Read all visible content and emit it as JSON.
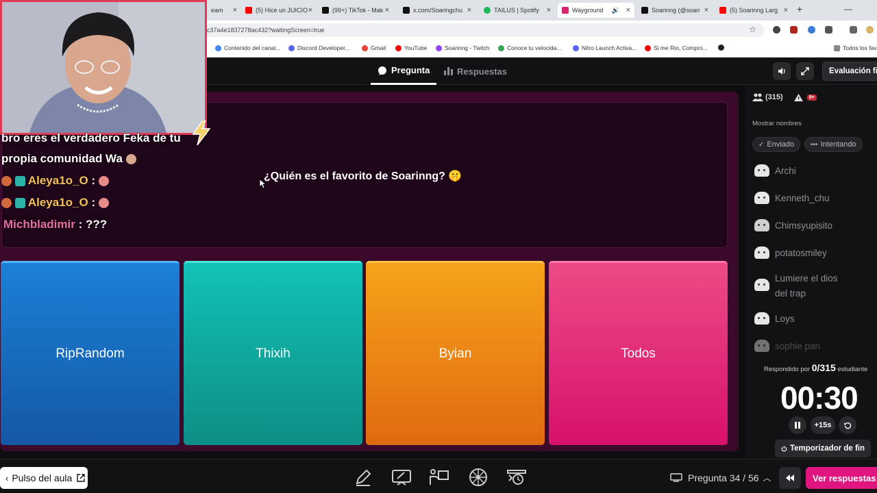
{
  "browser": {
    "tabs": [
      {
        "title": "eam",
        "favicon_color": "#9146ff"
      },
      {
        "title": "(5) Hice un JUICIO",
        "favicon_color": "#ff0000"
      },
      {
        "title": "(99+) TikTok - Mak",
        "favicon_color": "#111111"
      },
      {
        "title": "x.com/Soaringchu",
        "favicon_color": "#111111"
      },
      {
        "title": "TAILUS | Spotify",
        "favicon_color": "#1db954"
      },
      {
        "title": "Wayground",
        "favicon_color": "#d6246e"
      },
      {
        "title": "Soarinng (@soari",
        "favicon_color": "#111111"
      },
      {
        "title": "(5) Soarinng Larg",
        "favicon_color": "#ff0000"
      }
    ],
    "new_tab": "+",
    "url": "c37a4e1837278ac432?waitingScreen=true",
    "bookmarks": [
      {
        "label": "Contenido del canal...",
        "color": "#4285f4"
      },
      {
        "label": "Discord Developer...",
        "color": "#5865f2"
      },
      {
        "label": "Gmail",
        "color": "#ea4335"
      },
      {
        "label": "YouTube",
        "color": "#ff0000"
      },
      {
        "label": "Soarinng - Twitch",
        "color": "#9146ff"
      },
      {
        "label": "Conoce tu velocida...",
        "color": "#34a853"
      },
      {
        "label": "Nitro Launch Activa...",
        "color": "#5865f2"
      },
      {
        "label": "Si me Rio, Compro...",
        "color": "#ff0000"
      },
      {
        "label": "",
        "color": "#222222"
      },
      {
        "label": "Todos los fav",
        "color": "#888888"
      }
    ]
  },
  "header": {
    "tab_question": "Pregunta",
    "tab_answers": "Respuestas",
    "eval_button": "Evaluación fin"
  },
  "question": {
    "text": "¿Quién es el favorito de Soarinng? 🤫",
    "options": [
      "RipRandom",
      "Thixih",
      "Byian",
      "Todos"
    ]
  },
  "sidebar": {
    "participants": "(315)",
    "alerts": "9+",
    "show_names": "Mostrar nombres",
    "filter_sent": "Enviado",
    "filter_trying": "Intentando",
    "students": [
      "Archi",
      "Kenneth_chu",
      "Chimsyupisito",
      "potatosmiley",
      "Lumiere el dios",
      "del trap",
      "Loys",
      "sophie pan"
    ],
    "answered_prefix": "Respondido por",
    "answered_count": "0/315",
    "answered_suffix": "estudiante",
    "timer": "00:30",
    "add_time": "+15s",
    "end_timer": "Temporizador de fin"
  },
  "bottom": {
    "pulse": "Pulso del aula",
    "question_counter": "Pregunta 34 / 56",
    "view_answers": "Ver respuestas"
  },
  "stream_chat": {
    "line1": "bro eres el verdadero Feka de tu",
    "line2": "propia comunidad Wa",
    "user1": "Aleya1o_O",
    "sep": ":",
    "user3": "Michbladimir",
    "msg3": "???"
  },
  "colors": {
    "accent": "#e0157f",
    "option_blue": "#1b80d6",
    "option_teal": "#12c2b6",
    "option_orange": "#f6a31a",
    "option_pink": "#ec4b86"
  }
}
